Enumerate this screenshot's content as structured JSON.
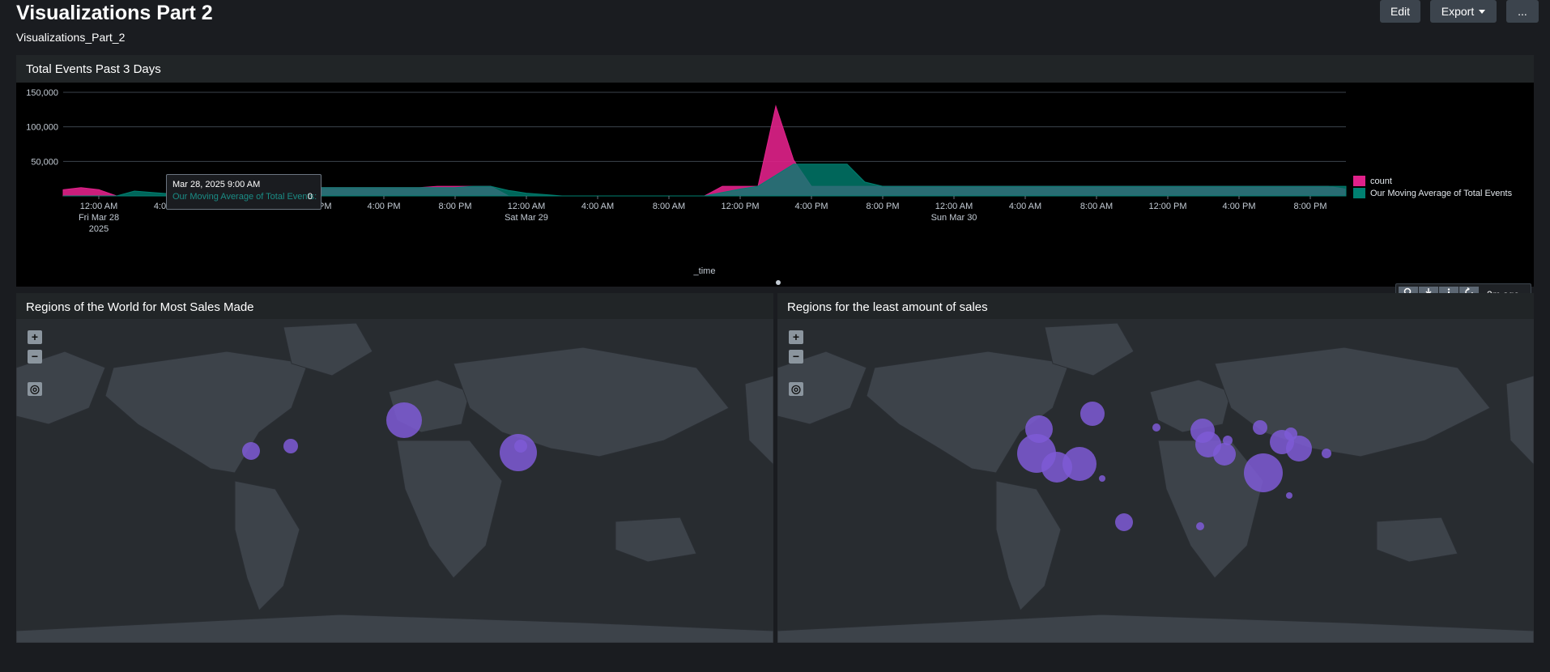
{
  "header": {
    "title": "Visualizations Part 2",
    "subtitle": "Visualizations_Part_2",
    "edit_label": "Edit",
    "export_label": "Export",
    "more_label": "..."
  },
  "timechart_panel": {
    "title": "Total Events Past 3 Days",
    "tooltip": {
      "time": "Mar 28, 2025 9:00 AM",
      "series": "Our Moving Average of Total Events:",
      "value": "0"
    },
    "legend": [
      {
        "label": "count",
        "color": "#e0218a"
      },
      {
        "label": "Our Moving Average of Total Events",
        "color": "#008071"
      }
    ],
    "x_axis_title": "_time"
  },
  "chart_data": {
    "type": "area",
    "xlabel": "_time",
    "ylabel": "",
    "ylim": [
      0,
      150000
    ],
    "y_ticks": [
      "150,000",
      "100,000",
      "50,000"
    ],
    "x_ticks": [
      {
        "line1": "12:00 AM",
        "line2": "Fri Mar 28",
        "line3": "2025"
      },
      {
        "line1": "4:00 AM"
      },
      {
        "line1": "8:00 AM"
      },
      {
        "line1": "12:00 PM"
      },
      {
        "line1": "4:00 PM"
      },
      {
        "line1": "8:00 PM"
      },
      {
        "line1": "12:00 AM",
        "line2": "Sat Mar 29"
      },
      {
        "line1": "4:00 AM"
      },
      {
        "line1": "8:00 AM"
      },
      {
        "line1": "12:00 PM"
      },
      {
        "line1": "4:00 PM"
      },
      {
        "line1": "8:00 PM"
      },
      {
        "line1": "12:00 AM",
        "line2": "Sun Mar 30"
      },
      {
        "line1": "4:00 AM"
      },
      {
        "line1": "8:00 AM"
      },
      {
        "line1": "12:00 PM"
      },
      {
        "line1": "4:00 PM"
      },
      {
        "line1": "8:00 PM"
      }
    ],
    "x": [
      "Mar 27 10PM",
      "Mar 27 11PM",
      "Mar 28 12AM",
      "Mar 28 1AM",
      "Mar 28 2AM",
      "Mar 28 3AM",
      "Mar 28 4AM",
      "Mar 28 5AM",
      "Mar 28 6AM",
      "Mar 28 7AM",
      "Mar 28 8AM",
      "Mar 28 9AM",
      "Mar 28 10AM",
      "Mar 28 11AM",
      "Mar 28 12PM",
      "Mar 28 1PM",
      "Mar 28 2PM",
      "Mar 28 3PM",
      "Mar 28 4PM",
      "Mar 28 5PM",
      "Mar 28 6PM",
      "Mar 28 7PM",
      "Mar 28 8PM",
      "Mar 28 9PM",
      "Mar 28 10PM",
      "Mar 28 11PM",
      "Mar 29 12AM",
      "Mar 29 1AM",
      "Mar 29 2AM",
      "Mar 29 3AM",
      "Mar 29 4AM",
      "Mar 29 5AM",
      "Mar 29 6AM",
      "Mar 29 7AM",
      "Mar 29 8AM",
      "Mar 29 9AM",
      "Mar 29 10AM",
      "Mar 29 11AM",
      "Mar 29 12PM",
      "Mar 29 1PM",
      "Mar 29 2PM",
      "Mar 29 3PM",
      "Mar 29 4PM",
      "Mar 29 5PM",
      "Mar 29 6PM",
      "Mar 29 7PM",
      "Mar 29 8PM",
      "Mar 29 9PM",
      "Mar 29 10PM",
      "Mar 29 11PM",
      "Mar 30 12AM",
      "Mar 30 1AM",
      "Mar 30 2AM",
      "Mar 30 3AM",
      "Mar 30 4AM",
      "Mar 30 5AM",
      "Mar 30 6AM",
      "Mar 30 7AM",
      "Mar 30 8AM",
      "Mar 30 9AM",
      "Mar 30 10AM",
      "Mar 30 11AM",
      "Mar 30 12PM",
      "Mar 30 1PM",
      "Mar 30 2PM",
      "Mar 30 3PM",
      "Mar 30 4PM",
      "Mar 30 5PM",
      "Mar 30 6PM",
      "Mar 30 7PM",
      "Mar 30 8PM",
      "Mar 30 9PM",
      "Mar 30 10PM"
    ],
    "series": [
      {
        "name": "count",
        "color": "#e0218a",
        "values": [
          9000,
          12000,
          9000,
          0,
          0,
          0,
          0,
          0,
          0,
          0,
          0,
          0,
          8000,
          11000,
          12000,
          12000,
          12000,
          12000,
          12000,
          12000,
          12000,
          14000,
          14000,
          14000,
          14000,
          0,
          0,
          0,
          0,
          0,
          0,
          0,
          0,
          0,
          0,
          0,
          0,
          14000,
          14000,
          14000,
          130000,
          52000,
          14000,
          14000,
          14000,
          14000,
          14000,
          14000,
          14000,
          14000,
          14000,
          14000,
          14000,
          14000,
          14000,
          14000,
          14000,
          14000,
          14000,
          14000,
          14000,
          14000,
          14000,
          14000,
          14000,
          14000,
          14000,
          14000,
          14000,
          14000,
          14000,
          14000,
          10000
        ]
      },
      {
        "name": "Our Moving Average of Total Events",
        "color": "#008071",
        "values": [
          0,
          0,
          0,
          0,
          7000,
          5000,
          3000,
          1000,
          0,
          0,
          0,
          0,
          8000,
          11000,
          12000,
          12000,
          12000,
          12000,
          12000,
          12000,
          12000,
          12000,
          12000,
          14000,
          14000,
          8000,
          4000,
          2000,
          0,
          0,
          0,
          0,
          0,
          0,
          0,
          0,
          0,
          5000,
          10000,
          14000,
          30000,
          46000,
          46000,
          46000,
          46000,
          20000,
          14000,
          14000,
          14000,
          14000,
          14000,
          14000,
          14000,
          14000,
          14000,
          14000,
          14000,
          14000,
          14000,
          14000,
          14000,
          14000,
          14000,
          14000,
          14000,
          14000,
          14000,
          14000,
          14000,
          14000,
          14000,
          14000,
          14000
        ]
      }
    ],
    "legend_position": "right",
    "grid": true
  },
  "map_left": {
    "title": "Regions of the World for Most Sales Made"
  },
  "map_right": {
    "title": "Regions for the least amount of sales"
  },
  "map_controls": {
    "zoom_in": "+",
    "zoom_out": "−",
    "locate": "◎"
  },
  "panel_toolbar": {
    "search_icon": "search-icon",
    "export_icon": "download-icon",
    "info_icon": "info-icon",
    "refresh_icon": "refresh-icon",
    "time_ago": "2m ago"
  },
  "colors": {
    "count": "#e0218a",
    "moving_average": "#008071",
    "bubble": "#7e5bd6"
  }
}
